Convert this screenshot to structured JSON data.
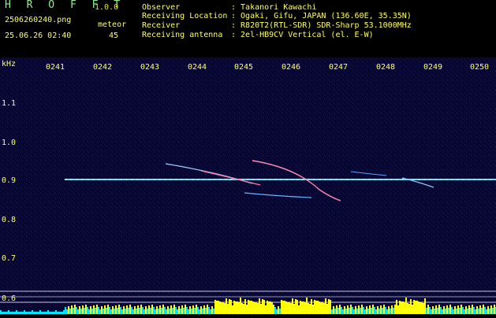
{
  "header": {
    "title": "H R O F F T",
    "version": "1.0.0",
    "filename": "2506260240.png",
    "datetime": "25.06.26 02:40",
    "meteor_label": "meteor",
    "meteor_count": "45",
    "info": [
      {
        "key": "Observer",
        "value": ": Takanori Kawachi"
      },
      {
        "key": "Receiving Location",
        "value": ": Ogaki, Gifu, JAPAN (136.60E, 35.35N)"
      },
      {
        "key": "Receiver",
        "value": ": R820T2(RTL-SDR) SDR-Sharp 53.1000MHz"
      },
      {
        "key": "Receiving antenna",
        "value": ": 2el-HB9CV Vertical (el. E-W)"
      }
    ]
  },
  "axes": {
    "freq_unit": "kHz",
    "time_labels": [
      "0241",
      "0242",
      "0243",
      "0244",
      "0245",
      "0246",
      "0247",
      "0248",
      "0249",
      "0250"
    ],
    "freq_labels": [
      "1.1",
      "1.0",
      "0.9",
      "0.8",
      "0.7",
      "0.6"
    ]
  },
  "colors": {
    "text_yellow": "#ffff66",
    "title_green": "#8ff08f",
    "background": "#05052a",
    "carrier": "#66ddff",
    "signal_yellow": "#ffff00",
    "signal_cyan": "#00e5ff"
  }
}
